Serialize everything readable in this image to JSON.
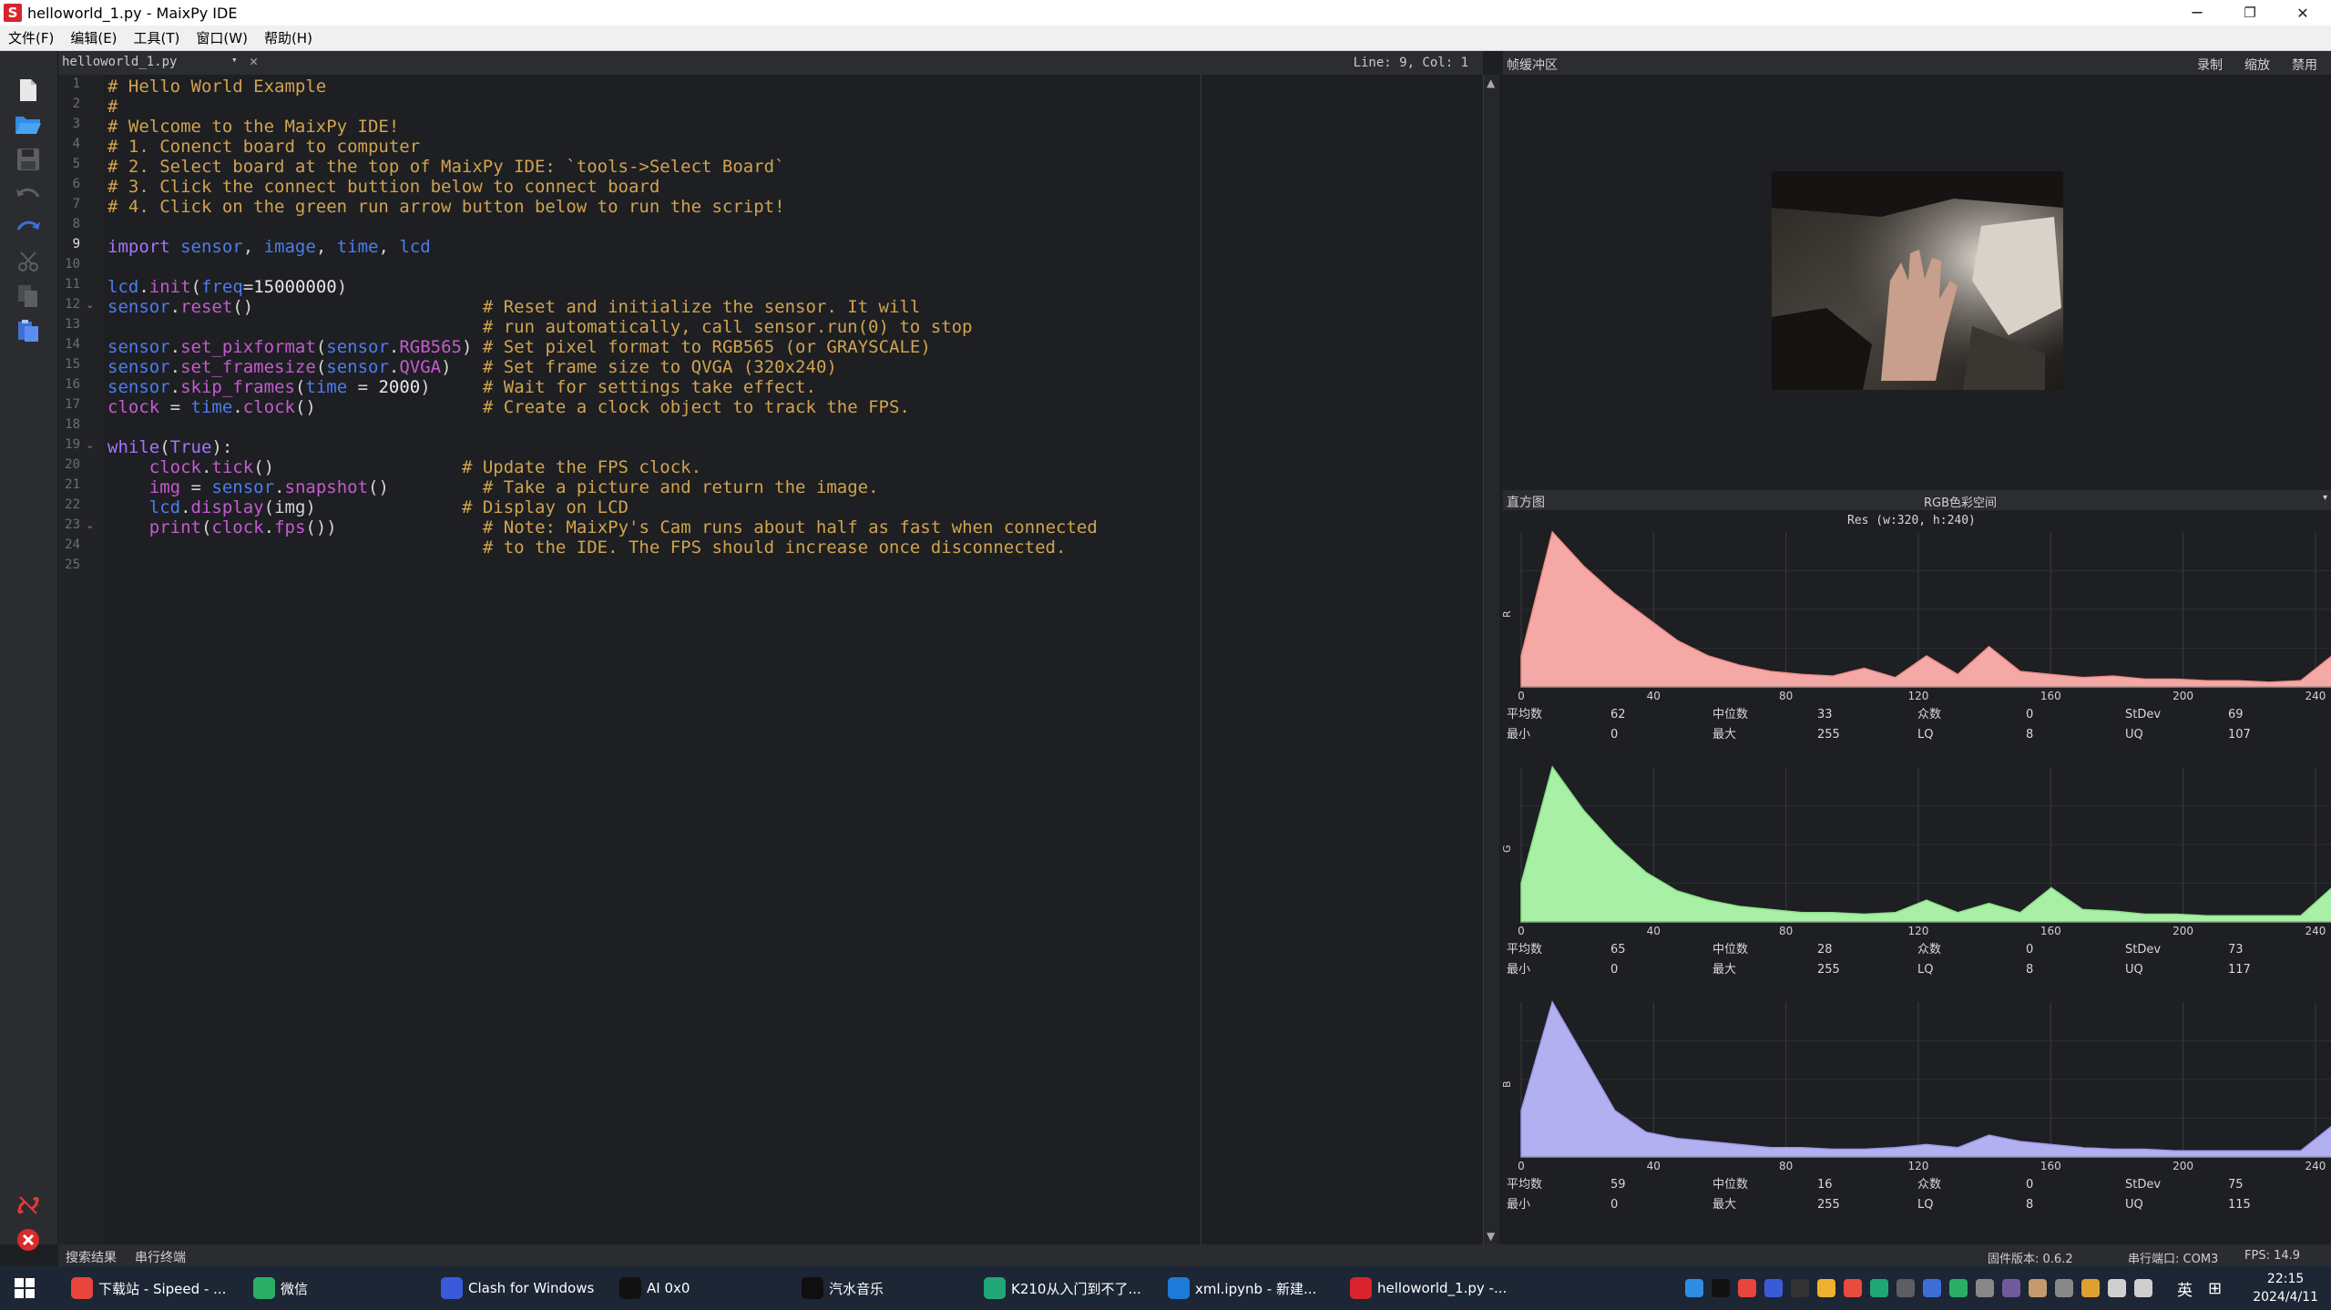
{
  "window": {
    "title": "helloworld_1.py - MaixPy IDE",
    "logo_letter": "S",
    "minimize": "─",
    "maximize": "❐",
    "close": "✕"
  },
  "menu": [
    "文件(F)",
    "编辑(E)",
    "工具(T)",
    "窗口(W)",
    "帮助(H)"
  ],
  "editor": {
    "tab_name": "helloworld_1.py",
    "tab_dropdown": "▾",
    "tab_close": "✕",
    "cursor_pos": "Line: 9, Col: 1",
    "current_line": 9,
    "fold_lines": [
      12,
      19,
      23
    ],
    "line_numbers": [
      "1",
      "2",
      "3",
      "4",
      "5",
      "6",
      "7",
      "8",
      "9",
      "10",
      "11",
      "12",
      "13",
      "14",
      "15",
      "16",
      "17",
      "18",
      "19",
      "20",
      "21",
      "22",
      "23",
      "24",
      "25"
    ],
    "lines": [
      [
        [
          "# Hello World Example",
          "cmt"
        ]
      ],
      [
        [
          "#",
          "cmt"
        ]
      ],
      [
        [
          "# Welcome to the MaixPy IDE!",
          "cmt"
        ]
      ],
      [
        [
          "# 1. Conenct board to computer",
          "cmt"
        ]
      ],
      [
        [
          "# 2. Select board at the top of MaixPy IDE: `tools->Select Board`",
          "cmt"
        ]
      ],
      [
        [
          "# 3. Click the connect buttion below to connect board",
          "cmt"
        ]
      ],
      [
        [
          "# 4. Click on the green run arrow button below to run the script!",
          "cmt"
        ]
      ],
      [],
      [
        [
          "import ",
          "kw"
        ],
        [
          "sensor",
          "mod"
        ],
        [
          ", ",
          "def"
        ],
        [
          "image",
          "mod"
        ],
        [
          ", ",
          "def"
        ],
        [
          "time",
          "mod"
        ],
        [
          ", ",
          "def"
        ],
        [
          "lcd",
          "mod"
        ]
      ],
      [],
      [
        [
          "lcd",
          "mod"
        ],
        [
          ".",
          "def"
        ],
        [
          "init",
          "fn"
        ],
        [
          "(",
          "def"
        ],
        [
          "freq",
          "mod"
        ],
        [
          "=",
          "def"
        ],
        [
          "15000000",
          "num"
        ],
        [
          ")",
          "def"
        ]
      ],
      [
        [
          "sensor",
          "mod"
        ],
        [
          ".",
          "def"
        ],
        [
          "reset",
          "fn"
        ],
        [
          "()                      ",
          "def"
        ],
        [
          "# Reset and initialize the sensor. It will",
          "cmt"
        ]
      ],
      [
        [
          "                                    ",
          "def"
        ],
        [
          "# run automatically, call sensor.run(0) to stop",
          "cmt"
        ]
      ],
      [
        [
          "sensor",
          "mod"
        ],
        [
          ".",
          "def"
        ],
        [
          "set_pixformat",
          "fn"
        ],
        [
          "(",
          "def"
        ],
        [
          "sensor",
          "mod"
        ],
        [
          ".",
          "def"
        ],
        [
          "RGB565",
          "fn"
        ],
        [
          ") ",
          "def"
        ],
        [
          "# Set pixel format to RGB565 (or GRAYSCALE)",
          "cmt"
        ]
      ],
      [
        [
          "sensor",
          "mod"
        ],
        [
          ".",
          "def"
        ],
        [
          "set_framesize",
          "fn"
        ],
        [
          "(",
          "def"
        ],
        [
          "sensor",
          "mod"
        ],
        [
          ".",
          "def"
        ],
        [
          "QVGA",
          "fn"
        ],
        [
          ")   ",
          "def"
        ],
        [
          "# Set frame size to QVGA (320x240)",
          "cmt"
        ]
      ],
      [
        [
          "sensor",
          "mod"
        ],
        [
          ".",
          "def"
        ],
        [
          "skip_frames",
          "fn"
        ],
        [
          "(",
          "def"
        ],
        [
          "time",
          "mod"
        ],
        [
          " = ",
          "def"
        ],
        [
          "2000",
          "num"
        ],
        [
          ")     ",
          "def"
        ],
        [
          "# Wait for settings take effect.",
          "cmt"
        ]
      ],
      [
        [
          "clock",
          "fn"
        ],
        [
          " = ",
          "def"
        ],
        [
          "time",
          "mod"
        ],
        [
          ".",
          "def"
        ],
        [
          "clock",
          "fn"
        ],
        [
          "()                ",
          "def"
        ],
        [
          "# Create a clock object to track the FPS.",
          "cmt"
        ]
      ],
      [],
      [
        [
          "while",
          "kw"
        ],
        [
          "(",
          "def"
        ],
        [
          "True",
          "kw"
        ],
        [
          "):",
          "def"
        ]
      ],
      [
        [
          "    ",
          "def"
        ],
        [
          "clock",
          "fn"
        ],
        [
          ".",
          "def"
        ],
        [
          "tick",
          "fn"
        ],
        [
          "()                  ",
          "def"
        ],
        [
          "# Update the FPS clock.",
          "cmt"
        ]
      ],
      [
        [
          "    ",
          "def"
        ],
        [
          "img",
          "fn"
        ],
        [
          " = ",
          "def"
        ],
        [
          "sensor",
          "mod"
        ],
        [
          ".",
          "def"
        ],
        [
          "snapshot",
          "fn"
        ],
        [
          "()         ",
          "def"
        ],
        [
          "# Take a picture and return the image.",
          "cmt"
        ]
      ],
      [
        [
          "    ",
          "def"
        ],
        [
          "lcd",
          "mod"
        ],
        [
          ".",
          "def"
        ],
        [
          "display",
          "fn"
        ],
        [
          "(img)              ",
          "def"
        ],
        [
          "# Display on LCD",
          "cmt"
        ]
      ],
      [
        [
          "    ",
          "def"
        ],
        [
          "print",
          "fn"
        ],
        [
          "(",
          "def"
        ],
        [
          "clock",
          "fn"
        ],
        [
          ".",
          "def"
        ],
        [
          "fps",
          "fn"
        ],
        [
          "())              ",
          "def"
        ],
        [
          "# Note: MaixPy's Cam runs about half as fast when connected",
          "cmt"
        ]
      ],
      [
        [
          "                                    ",
          "def"
        ],
        [
          "# to the IDE. The FPS should increase once disconnected.",
          "cmt"
        ]
      ],
      []
    ]
  },
  "framebuffer": {
    "title": "帧缓冲区",
    "record": "录制",
    "zoom": "缩放",
    "disable": "禁用"
  },
  "histogram": {
    "title": "直方图",
    "color_space": "RGB色彩空间",
    "dropdown": "▾",
    "resolution": "Res (w:320, h:240)",
    "x_ticks": [
      "0",
      "40",
      "80",
      "120",
      "160",
      "200",
      "240"
    ],
    "stat_labels": {
      "mean": "平均数",
      "median": "中位数",
      "mode": "众数",
      "stdev": "StDev",
      "min": "最小",
      "max": "最大",
      "lq": "LQ",
      "uq": "UQ"
    },
    "channels": [
      {
        "axis_label": "R",
        "fill": "#f4a9a6",
        "stroke": "#f08c88",
        "stats": {
          "mean": "62",
          "median": "33",
          "mode": "0",
          "stdev": "69",
          "min": "0",
          "max": "255",
          "lq": "8",
          "uq": "107"
        },
        "values": [
          0.2,
          1.0,
          0.78,
          0.6,
          0.45,
          0.3,
          0.2,
          0.14,
          0.1,
          0.08,
          0.07,
          0.12,
          0.06,
          0.2,
          0.08,
          0.26,
          0.1,
          0.08,
          0.06,
          0.07,
          0.05,
          0.05,
          0.04,
          0.04,
          0.03,
          0.04,
          0.2
        ]
      },
      {
        "axis_label": "G",
        "fill": "#a8f0a6",
        "stroke": "#8be088",
        "stats": {
          "mean": "65",
          "median": "28",
          "mode": "0",
          "stdev": "73",
          "min": "0",
          "max": "255",
          "lq": "8",
          "uq": "117"
        },
        "values": [
          0.25,
          1.0,
          0.72,
          0.5,
          0.32,
          0.2,
          0.14,
          0.1,
          0.08,
          0.06,
          0.06,
          0.05,
          0.06,
          0.14,
          0.06,
          0.12,
          0.06,
          0.22,
          0.08,
          0.07,
          0.05,
          0.05,
          0.04,
          0.04,
          0.04,
          0.04,
          0.22
        ]
      },
      {
        "axis_label": "B",
        "fill": "#b3b0f2",
        "stroke": "#9c98ea",
        "stats": {
          "mean": "59",
          "median": "16",
          "mode": "0",
          "stdev": "75",
          "min": "0",
          "max": "255",
          "lq": "8",
          "uq": "115"
        },
        "values": [
          0.3,
          1.0,
          0.65,
          0.3,
          0.16,
          0.12,
          0.1,
          0.08,
          0.06,
          0.06,
          0.05,
          0.05,
          0.06,
          0.08,
          0.06,
          0.14,
          0.1,
          0.08,
          0.06,
          0.05,
          0.05,
          0.04,
          0.04,
          0.04,
          0.04,
          0.04,
          0.2
        ]
      }
    ]
  },
  "bottombar": {
    "search_results": "搜索结果",
    "serial_terminal": "串行终端",
    "firmware": "固件版本: 0.6.2",
    "serial_port": "串行端口: COM3",
    "fps": "FPS: 14.9"
  },
  "taskbar": {
    "items": [
      {
        "label": "下载站 - Sipeed - ...",
        "icon": "chrome-icon",
        "color": "#e8453c"
      },
      {
        "label": "微信",
        "icon": "wechat-icon",
        "color": "#2aae67"
      },
      {
        "label": "Clash for Windows",
        "icon": "clash-icon",
        "color": "#3a5bd9"
      },
      {
        "label": "AI 0x0",
        "icon": "ai0x0-icon",
        "color": "#111111"
      },
      {
        "label": "汽水音乐",
        "icon": "music-icon",
        "color": "#0f0f0f"
      },
      {
        "label": "K210从入门到不了...",
        "icon": "edge-icon",
        "color": "#1fa776"
      },
      {
        "label": "xml.ipynb - 新建...",
        "icon": "vscode-icon",
        "color": "#1e7ad8"
      },
      {
        "label": "helloworld_1.py -...",
        "icon": "maixpy-icon",
        "color": "#d9232d"
      }
    ],
    "ime": "英",
    "keyboard": "⊞",
    "time": "22:15",
    "date": "2024/4/11"
  }
}
